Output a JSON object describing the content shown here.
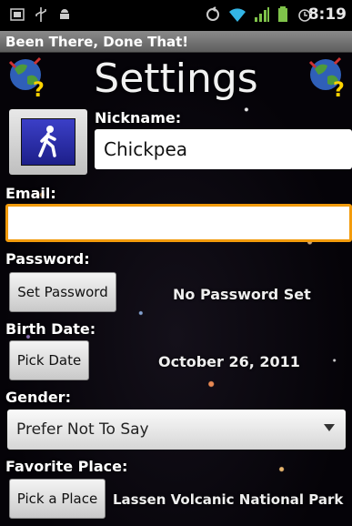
{
  "status_bar": {
    "time": "8:19",
    "icons": [
      "screen-icon",
      "usb-icon",
      "android-icon",
      "sync-icon",
      "wifi-icon",
      "signal-icon",
      "battery-icon",
      "alarm-icon"
    ]
  },
  "app_title": "Been There, Done That!",
  "heading": "Settings",
  "nickname": {
    "label": "Nickname:",
    "value": "Chickpea"
  },
  "email": {
    "label": "Email:",
    "value": ""
  },
  "password": {
    "label": "Password:",
    "button": "Set Password",
    "status": "No Password Set"
  },
  "birth_date": {
    "label": "Birth Date:",
    "button": "Pick Date",
    "value": "October 26, 2011"
  },
  "gender": {
    "label": "Gender:",
    "selected": "Prefer Not To Say"
  },
  "favorite_place": {
    "label": "Favorite Place:",
    "button": "Pick a Place",
    "value": "Lassen Volcanic National Park"
  },
  "colors": {
    "focus": "#f29b0c",
    "avatar": "#2a2eb0"
  }
}
